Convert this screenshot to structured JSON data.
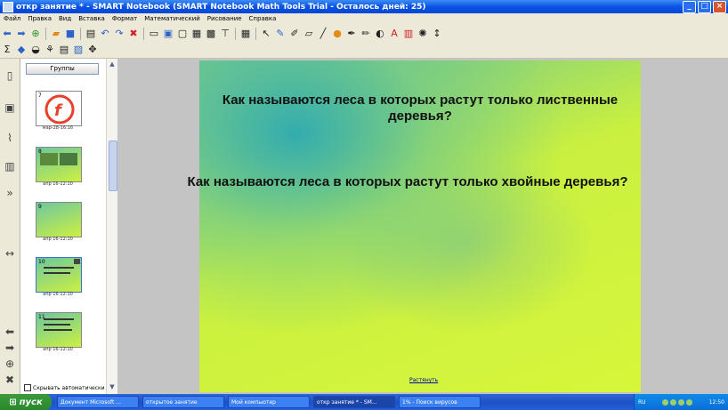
{
  "window": {
    "title": "откр занятие * - SMART Notebook (SMART Notebook Math Tools Trial - Осталось дней: 25)"
  },
  "menu": [
    "Файл",
    "Правка",
    "Вид",
    "Вставка",
    "Формат",
    "Математический",
    "Рисование",
    "Справка"
  ],
  "sorter": {
    "groups_label": "Группы",
    "thumbnails": [
      {
        "number": "7",
        "caption": "мар-28-16:16"
      },
      {
        "number": "8",
        "caption": "апр 16-12:10"
      },
      {
        "number": "9",
        "caption": "апр 16-12:10"
      },
      {
        "number": "10",
        "caption": "апр 16-12:10"
      },
      {
        "number": "11",
        "caption": "апр 16-12:10"
      }
    ],
    "autohide_label": "Скрывать автоматически"
  },
  "slide": {
    "question1": "Как называются леса в которых растут только лиственные деревья?",
    "question2": "Как называются леса в которых растут только хвойные деревья?",
    "expand_link": "Растянуть"
  },
  "taskbar": {
    "start_label": "пуск",
    "items": [
      "Документ Microsoft ...",
      "открытое занятие",
      "Мой компьютер",
      "откр занятие * - SM...",
      "1% - Поиск вирусов"
    ],
    "language": "RU",
    "clock": "12:50"
  }
}
